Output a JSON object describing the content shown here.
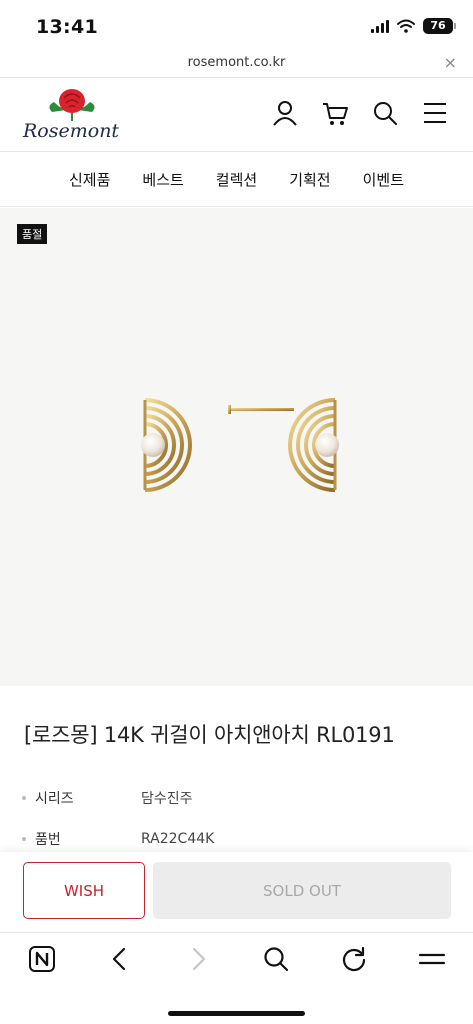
{
  "status_bar": {
    "time": "13:41",
    "battery": "76"
  },
  "browser": {
    "url": "rosemont.co.kr",
    "close_label": "×"
  },
  "header": {
    "logo_text": "Rosemont",
    "icons": [
      "user-icon",
      "cart-icon",
      "search-icon",
      "menu-icon"
    ]
  },
  "nav": {
    "items": [
      {
        "label": "신제품"
      },
      {
        "label": "베스트"
      },
      {
        "label": "컬렉션"
      },
      {
        "label": "기획전"
      },
      {
        "label": "이벤트"
      }
    ]
  },
  "product": {
    "badge": "품절",
    "title": "[로즈몽] 14K 귀걸이 아치앤아치 RL0191",
    "specs": [
      {
        "label": "시리즈",
        "value": "담수진주"
      },
      {
        "label": "품번",
        "value": "RA22C44K"
      }
    ]
  },
  "actions": {
    "wish_label": "WISH",
    "soldout_label": "SOLD OUT"
  },
  "toolbar": {
    "icons": [
      "naver-home-icon",
      "back-icon",
      "forward-icon",
      "search-icon",
      "refresh-icon",
      "menu-icon"
    ]
  },
  "colors": {
    "accent": "#c4242f",
    "disabled_bg": "#ececec",
    "image_bg": "#f6f6f5"
  }
}
